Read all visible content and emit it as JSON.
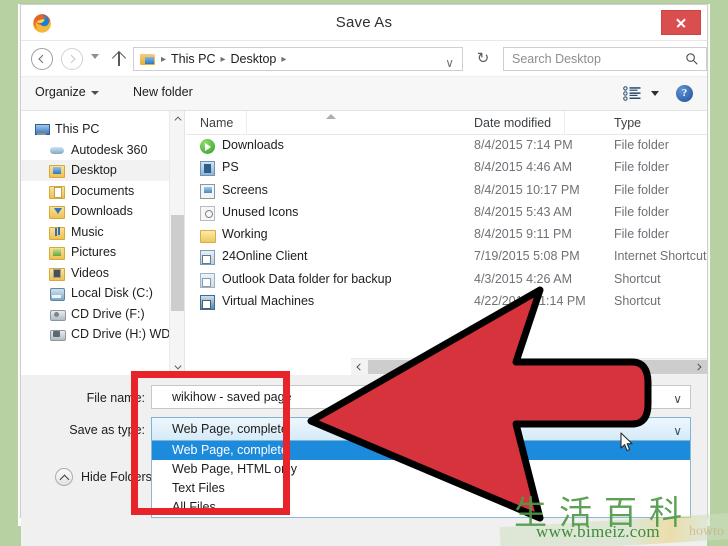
{
  "window": {
    "title": "Save As",
    "app_icon": "firefox-icon",
    "close_label": "×"
  },
  "navbar": {
    "back_icon": "back-arrow-icon",
    "forward_icon": "forward-arrow-icon",
    "recent_icon": "recent-locations-caret-icon",
    "up_icon": "up-arrow-icon",
    "breadcrumbs": [
      "This PC",
      "Desktop"
    ],
    "breadcrumb_separator": "▸",
    "dropdown_caret": "∨",
    "refresh_icon": "↻",
    "search_placeholder": "Search Desktop",
    "search_icon": "search-icon"
  },
  "toolbar": {
    "organize_label": "Organize",
    "new_folder_label": "New folder",
    "view_icon": "view-list-icon",
    "view_caret": "chevron-down-icon",
    "help_label": "?"
  },
  "sidebar": {
    "items": [
      {
        "label": "This PC",
        "icon": "computer-icon",
        "indent": false,
        "selected": false
      },
      {
        "label": "Autodesk 360",
        "icon": "cloud-icon",
        "indent": true,
        "selected": false
      },
      {
        "label": "Desktop",
        "icon": "desktop-folder-icon",
        "indent": true,
        "selected": true
      },
      {
        "label": "Documents",
        "icon": "documents-folder-icon",
        "indent": true,
        "selected": false
      },
      {
        "label": "Downloads",
        "icon": "downloads-folder-icon",
        "indent": true,
        "selected": false
      },
      {
        "label": "Music",
        "icon": "music-folder-icon",
        "indent": true,
        "selected": false
      },
      {
        "label": "Pictures",
        "icon": "pictures-folder-icon",
        "indent": true,
        "selected": false
      },
      {
        "label": "Videos",
        "icon": "videos-folder-icon",
        "indent": true,
        "selected": false
      },
      {
        "label": "Local Disk (C:)",
        "icon": "hard-disk-icon",
        "indent": true,
        "selected": false
      },
      {
        "label": "CD Drive (F:)",
        "icon": "cd-drive-icon",
        "indent": true,
        "selected": false
      },
      {
        "label": "CD Drive (H:) WD",
        "icon": "cd-drive-locked-icon",
        "indent": true,
        "selected": false
      }
    ],
    "scroll_up_icon": "scroll-up-arrow-icon",
    "scroll_down_icon": "scroll-down-arrow-icon"
  },
  "filelist": {
    "columns": [
      "Name",
      "Date modified",
      "Type"
    ],
    "sort_indicator": "sort-ascending-icon",
    "rows": [
      {
        "name": "Downloads",
        "date": "8/4/2015 7:14 PM",
        "type": "File folder",
        "icon": "downloads-green-icon"
      },
      {
        "name": "PS",
        "date": "8/4/2015 4:46 AM",
        "type": "File folder",
        "icon": "ps-folder-icon"
      },
      {
        "name": "Screens",
        "date": "8/4/2015 10:17 PM",
        "type": "File folder",
        "icon": "screens-folder-icon"
      },
      {
        "name": "Unused Icons",
        "date": "8/4/2015 5:43 AM",
        "type": "File folder",
        "icon": "unused-icons-folder-icon"
      },
      {
        "name": "Working",
        "date": "8/4/2015 9:11 PM",
        "type": "File folder",
        "icon": "working-folder-icon"
      },
      {
        "name": "24Online Client",
        "date": "7/19/2015 5:08 PM",
        "type": "Internet Shortcut",
        "icon": "internet-shortcut-icon"
      },
      {
        "name": "Outlook Data folder for backup",
        "date": "4/3/2015 4:26 AM",
        "type": "Shortcut",
        "icon": "shortcut-icon"
      },
      {
        "name": "Virtual Machines",
        "date": "4/22/2015 11:14 PM",
        "type": "Shortcut",
        "icon": "virtual-machines-shortcut-icon"
      }
    ],
    "hscroll_left_icon": "scroll-left-arrow-icon",
    "hscroll_right_icon": "scroll-right-arrow-icon"
  },
  "footer": {
    "filename_label": "File name:",
    "filename_value": "wikihow - saved page",
    "filename_caret": "∨",
    "savetype_label": "Save as type:",
    "savetype_value": "Web Page, complete",
    "savetype_caret": "∨",
    "savetype_options": [
      {
        "label": "Web Page, complete",
        "highlighted": true
      },
      {
        "label": "Web Page, HTML only",
        "highlighted": false
      },
      {
        "label": "Text Files",
        "highlighted": false
      },
      {
        "label": "All Files",
        "highlighted": false
      }
    ],
    "hide_folders_label": "Hide Folders",
    "hide_folders_icon": "chevron-up-circle-icon"
  },
  "annotations": {
    "highlight_box_color": "#e8232a",
    "arrow_color": "#d6333d",
    "arrow_outline_color": "#000000",
    "cursor_icon": "mouse-pointer-icon"
  },
  "watermark": {
    "cjk_text": "生活百科",
    "url": "www.bimeiz.com",
    "faded_text": "howto",
    "color": "#4f9a48"
  },
  "theme": {
    "matte_green": "#b7d1a2",
    "accent_blue": "#1c8bdc",
    "close_red": "#d94f4f"
  }
}
